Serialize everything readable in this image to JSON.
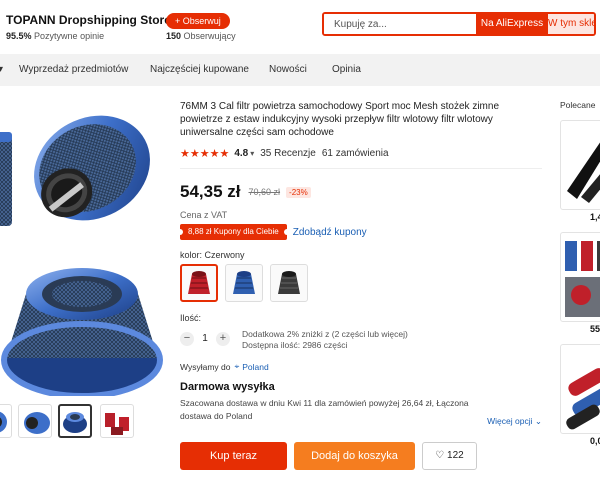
{
  "store": {
    "name": "TOPANN Dropshipping Store",
    "positive_percent": "95.5%",
    "positive_label": "Pozytywne opinie",
    "follow_label": "+ Obserwuj",
    "followers_count": "150",
    "followers_label": "Obserwujący"
  },
  "search": {
    "placeholder": "Kupuję za...",
    "btn_aliexpress": "Na AliExpress",
    "btn_store": "W tym sklepie"
  },
  "nav": {
    "items": [
      "Wyprzedaż przedmiotów",
      "Najczęściej kupowane",
      "Nowości",
      "Opinia"
    ]
  },
  "product": {
    "title": "76MM 3 Cal filtr powietrza samochodowy Sport moc Mesh stożek zimne powietrze z estaw indukcyjny wysoki przepływ filtr wlotowy filtr wlotowy uniwersalne części sam ochodowe",
    "stars": "★★★★★",
    "rating": "4.8",
    "reviews": "35 Recenzje",
    "orders": "61 zamówienia",
    "price": "54,35 zł",
    "old_price": "70,60 zł",
    "discount": "-23%",
    "vat": "Cena z VAT",
    "coupon": "8,88 zł Kupony dla Ciebie",
    "coupon_link": "Zdobądź kupony",
    "color_label": "kolor: Czerwony",
    "colors": [
      {
        "name": "Czerwony",
        "color": "#c0202a"
      },
      {
        "name": "Niebieski",
        "color": "#2f5fb0"
      },
      {
        "name": "Czarny",
        "color": "#3a3a3a"
      }
    ],
    "qty_label": "Ilość:",
    "qty_value": "1",
    "qty_note_1": "Dodatkowa 2% zniżki z (2 części lub więcej)",
    "qty_note_2": "Dostępna ilość: 2986 części",
    "ship_label": "Wysyłamy do",
    "ship_country": "Poland",
    "free_shipping": "Darmowa wysyłka",
    "shipping_desc": "Szacowana dostawa w dniu Kwi 11 dla zamówień powyżej 26,64 zł, Łączona dostawa do Poland",
    "more_options": "Więcej opcji",
    "buy_now": "Kup teraz",
    "add_to_cart": "Dodaj do koszyka",
    "wishlist_count": "122"
  },
  "recommended": {
    "title": "Polecane",
    "prices": [
      "1,4",
      "55,",
      "0,0"
    ]
  },
  "colors": {
    "accent": "#e62e04",
    "cart": "#f57d1f",
    "link": "#1a5fb4",
    "filter_blue": "#3d6fc9"
  }
}
